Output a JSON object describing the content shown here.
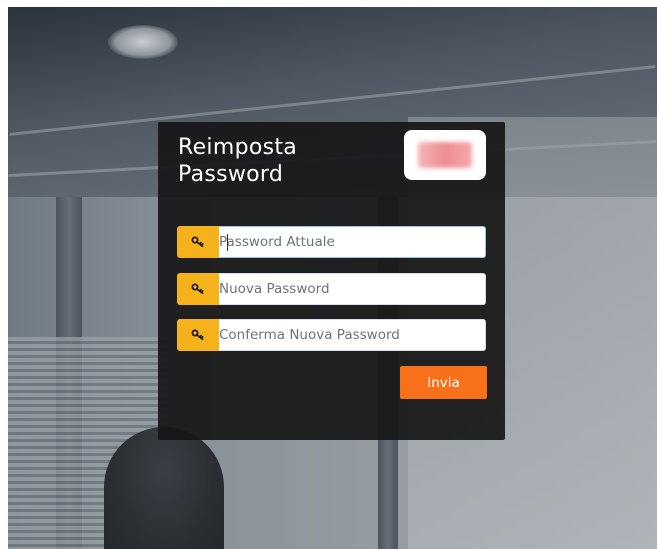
{
  "form": {
    "title_line1": "Reimposta",
    "title_line2": "Password",
    "fields": [
      {
        "icon": "key-icon",
        "placeholder": "Password Attuale",
        "value": ""
      },
      {
        "icon": "key-icon",
        "placeholder": "Nuova Password",
        "value": ""
      },
      {
        "icon": "key-icon",
        "placeholder": "Conferma Nuova Password",
        "value": ""
      }
    ],
    "submit_label": "Invia"
  },
  "colors": {
    "key_button": "#f6b21b",
    "submit_button": "#f8711a",
    "panel_background": "#161616"
  },
  "logo": {
    "icon": "company-logo-blurred"
  }
}
